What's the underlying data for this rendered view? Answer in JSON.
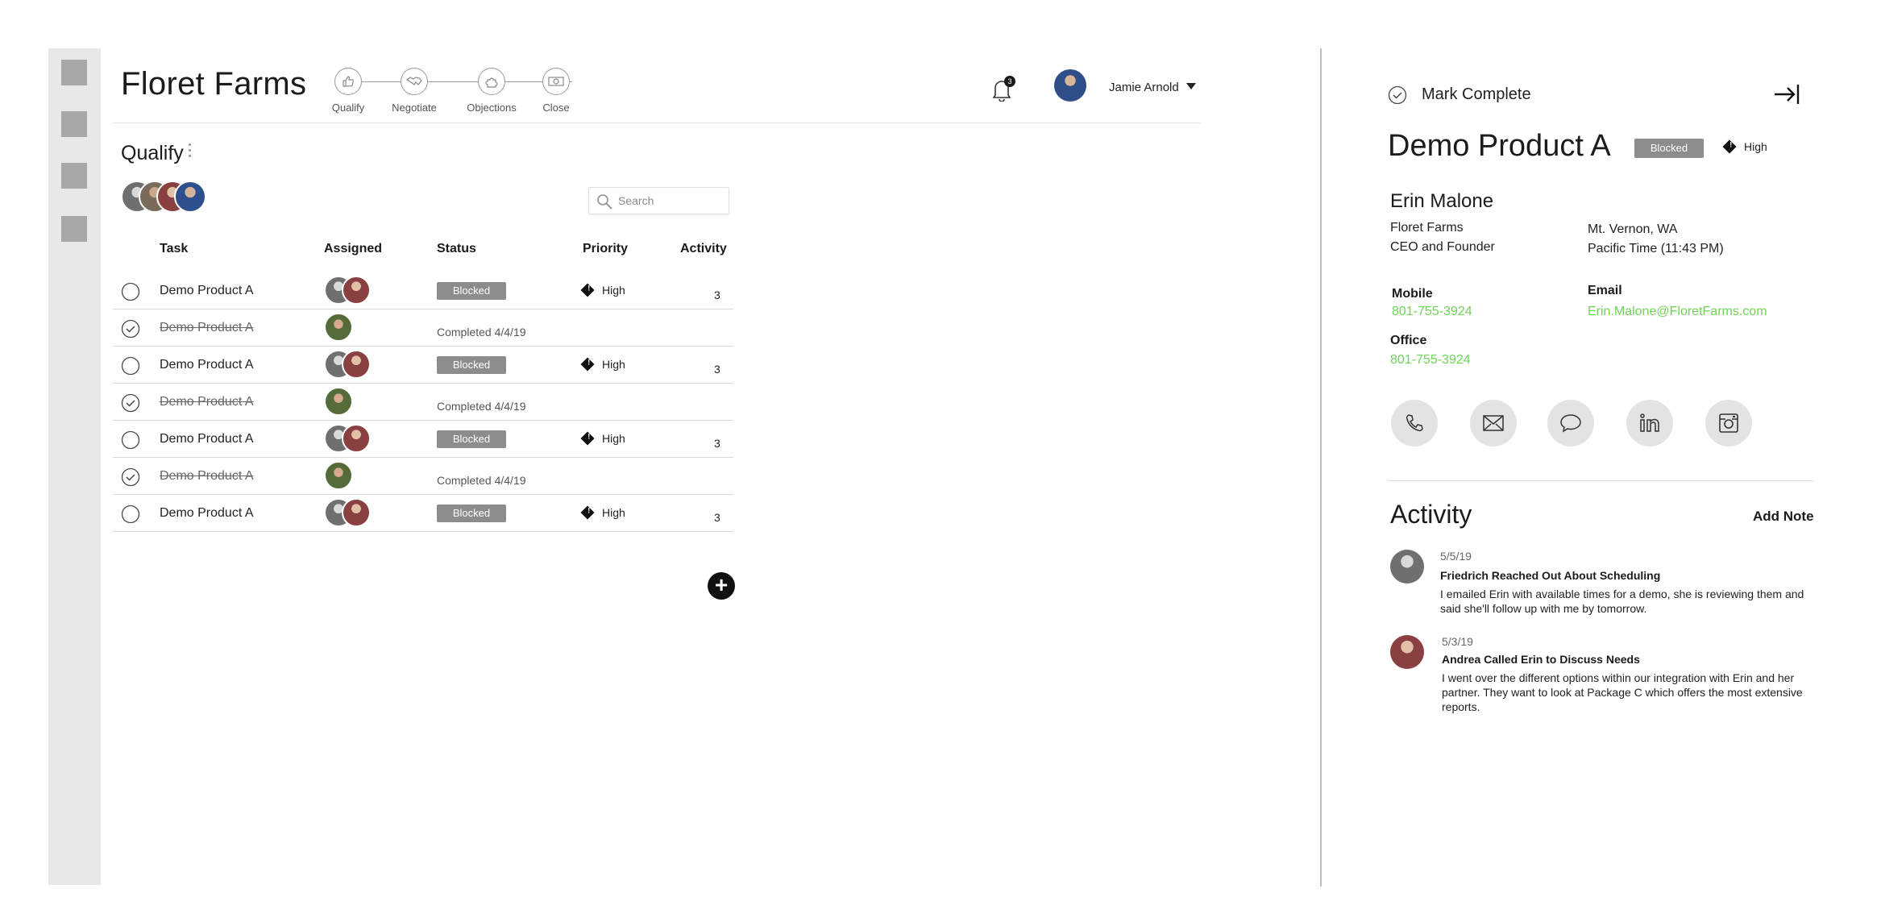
{
  "left_rail": {
    "items": [
      "nav-1",
      "nav-2",
      "nav-3",
      "nav-4"
    ]
  },
  "header": {
    "brand": "Floret Farms",
    "stages": [
      {
        "label": "Qualify",
        "icon": "thumbs-up-icon"
      },
      {
        "label": "Negotiate",
        "icon": "handshake-icon"
      },
      {
        "label": "Objections",
        "icon": "puzzle-icon"
      },
      {
        "label": "Close",
        "icon": "money-icon"
      }
    ],
    "notifications": {
      "count": "3"
    },
    "user": {
      "name": "Jamie Arnold"
    }
  },
  "section": {
    "title": "Qualify"
  },
  "search": {
    "placeholder": "Search"
  },
  "table": {
    "columns": {
      "task": "Task",
      "assigned": "Assigned",
      "status": "Status",
      "priority": "Priority",
      "activity": "Activity"
    },
    "rows": [
      {
        "task": "Demo Product A",
        "done": false,
        "status": "Blocked",
        "priority": "High",
        "activity": "3"
      },
      {
        "task": "Demo Product A",
        "done": true,
        "status": "Completed 4/4/19",
        "priority": "",
        "activity": ""
      },
      {
        "task": "Demo Product A",
        "done": false,
        "status": "Blocked",
        "priority": "High",
        "activity": "3"
      },
      {
        "task": "Demo Product A",
        "done": true,
        "status": "Completed 4/4/19",
        "priority": "",
        "activity": ""
      },
      {
        "task": "Demo Product A",
        "done": false,
        "status": "Blocked",
        "priority": "High",
        "activity": "3"
      },
      {
        "task": "Demo Product A",
        "done": true,
        "status": "Completed 4/4/19",
        "priority": "",
        "activity": ""
      },
      {
        "task": "Demo Product A",
        "done": false,
        "status": "Blocked",
        "priority": "High",
        "activity": "3"
      }
    ]
  },
  "panel": {
    "mark_complete": "Mark Complete",
    "title": "Demo Product A",
    "status": "Blocked",
    "priority": "High",
    "contact": {
      "name": "Erin Malone",
      "company": "Floret Farms",
      "role": "CEO and Founder",
      "location": "Mt. Vernon, WA",
      "timezone": "Pacific Time (11:43 PM)",
      "mobile_label": "Mobile",
      "mobile": "801-755-3924",
      "email_label": "Email",
      "email": "Erin.Malone@FloretFarms.com",
      "office_label": "Office",
      "office": "801-755-3924"
    },
    "activity_title": "Activity",
    "add_note": "Add Note",
    "feed": [
      {
        "date": "5/5/19",
        "title": "Friedrich Reached Out About Scheduling",
        "body": "I emailed Erin with available times for a demo, she is reviewing them and said she'll follow up with me by tomorrow."
      },
      {
        "date": "5/3/19",
        "title": "Andrea Called Erin to Discuss Needs",
        "body": "I went over the different options within our integration with Erin and her partner. They want to look at Package C which offers the most extensive reports."
      }
    ]
  },
  "colors": {
    "link_green": "#6fd356",
    "badge_gray": "#8c8c8c",
    "rail_bg": "#e8e8e8"
  }
}
